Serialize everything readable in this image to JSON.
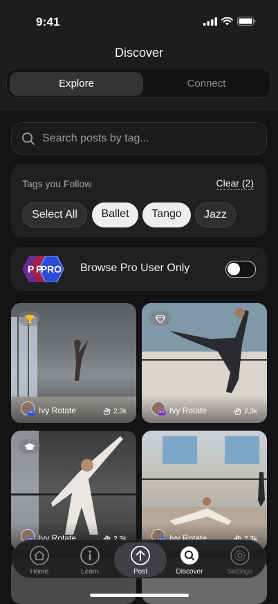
{
  "status": {
    "time": "9:41"
  },
  "header": {
    "title": "Discover",
    "tabs": [
      {
        "label": "Explore"
      },
      {
        "label": "Connect"
      }
    ]
  },
  "search": {
    "placeholder": "Search posts by tag..."
  },
  "tags": {
    "heading": "Tags you Follow",
    "clear_label": "Clear (2)",
    "chips": [
      {
        "label": "Select All",
        "selected": false
      },
      {
        "label": "Ballet",
        "selected": true
      },
      {
        "label": "Tango",
        "selected": true
      },
      {
        "label": "Jazz",
        "selected": false
      }
    ]
  },
  "pro_filter": {
    "label": "Browse Pro User Only",
    "badge_text": "PRO",
    "enabled": false
  },
  "posts": [
    {
      "user": "Ivy Rotate",
      "likes": "2,3k",
      "badge": "trophy-icon"
    },
    {
      "user": "Ivy Rotate",
      "likes": "2,3k",
      "badge": "diamond-icon"
    },
    {
      "user": "Ivy Rotate",
      "likes": "2,3k",
      "badge": "graduation-cap-icon"
    },
    {
      "user": "Ivy Rotate",
      "likes": "2,3k",
      "badge": ""
    }
  ],
  "nav": {
    "items": [
      {
        "label": "Home",
        "icon": "home-icon"
      },
      {
        "label": "Learn",
        "icon": "info-icon"
      },
      {
        "label": "Post",
        "icon": "upload-icon"
      },
      {
        "label": "Discover",
        "icon": "search-icon"
      },
      {
        "label": "Settings",
        "icon": "settings-icon"
      }
    ],
    "active": "Post"
  }
}
